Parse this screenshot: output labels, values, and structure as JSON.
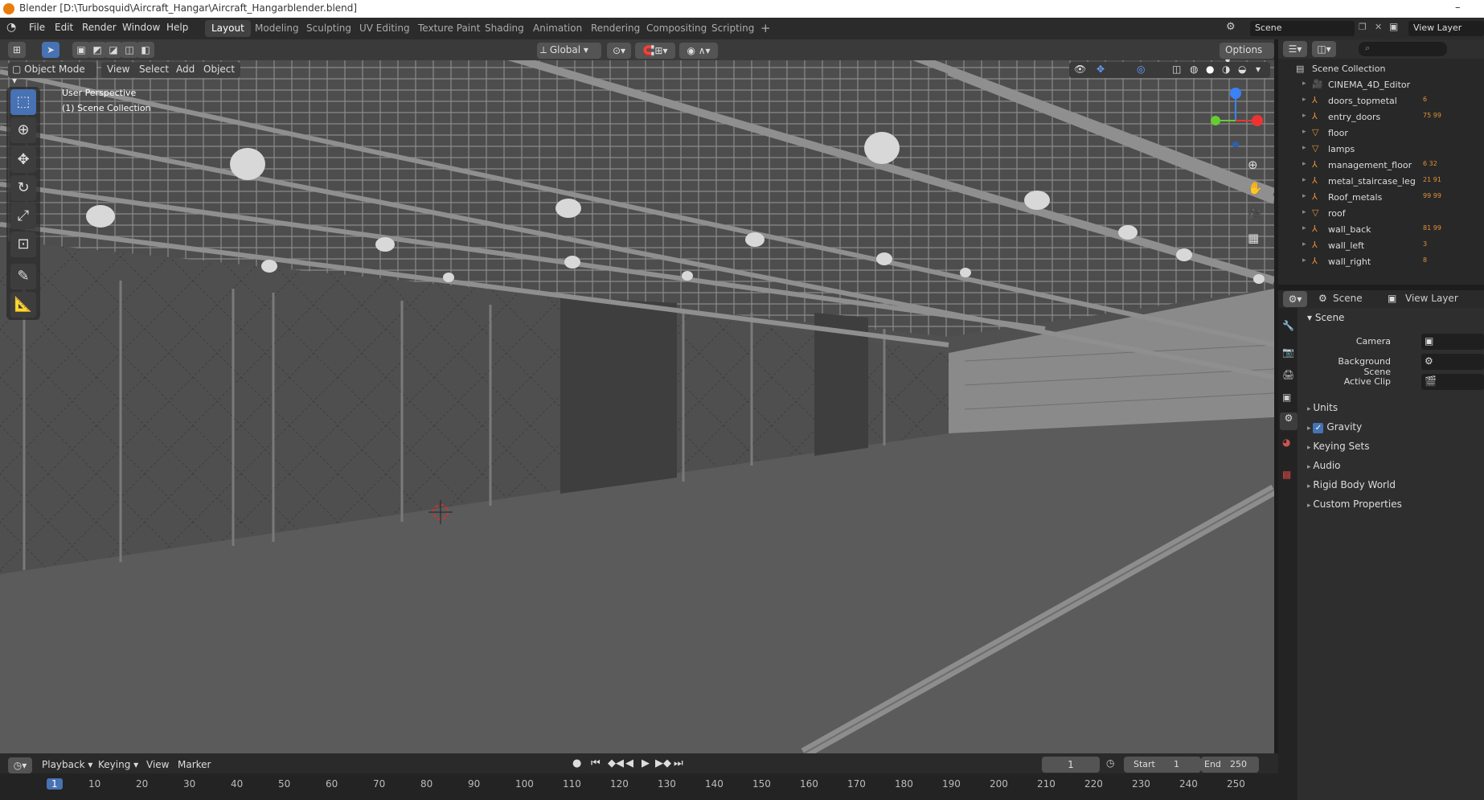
{
  "window": {
    "title": "Blender [D:\\Turbosquid\\Aircraft_Hangar\\Aircraft_Hangarblender.blend]",
    "minimize": "–"
  },
  "menu": [
    "File",
    "Edit",
    "Render",
    "Window",
    "Help"
  ],
  "workspaces": [
    "Layout",
    "Modeling",
    "Sculpting",
    "UV Editing",
    "Texture Paint",
    "Shading",
    "Animation",
    "Rendering",
    "Compositing",
    "Scripting"
  ],
  "active_workspace": "Layout",
  "scene_field": "Scene",
  "view_layer_field": "View Layer",
  "viewport": {
    "transform_orientation": "Global",
    "options_label": "Options",
    "mode": "Object Mode",
    "header_menus": [
      "View",
      "Select",
      "Add",
      "Object"
    ],
    "overlay_line1": "User Perspective",
    "overlay_line2": "(1) Scene Collection"
  },
  "outliner": {
    "root": "Scene Collection",
    "items": [
      {
        "name": "CINEMA_4D_Editor",
        "icon": "camera-icon",
        "badges": ""
      },
      {
        "name": "doors_topmetal",
        "icon": "empty-icon",
        "badges": "6"
      },
      {
        "name": "entry_doors",
        "icon": "empty-icon",
        "badges": "75 99"
      },
      {
        "name": "floor",
        "icon": "mesh-icon",
        "badges": ""
      },
      {
        "name": "lamps",
        "icon": "mesh-icon",
        "badges": ""
      },
      {
        "name": "management_floor",
        "icon": "empty-icon",
        "badges": "6 32"
      },
      {
        "name": "metal_staircase_leg",
        "icon": "empty-icon",
        "badges": "21 91"
      },
      {
        "name": "Roof_metals",
        "icon": "empty-icon",
        "badges": "99 99"
      },
      {
        "name": "roof",
        "icon": "mesh-icon",
        "badges": ""
      },
      {
        "name": "wall_back",
        "icon": "empty-icon",
        "badges": "81 99"
      },
      {
        "name": "wall_left",
        "icon": "empty-icon",
        "badges": "3"
      },
      {
        "name": "wall_right",
        "icon": "empty-icon",
        "badges": "8"
      }
    ]
  },
  "properties": {
    "tab_scene": "Scene",
    "tab_view_layer": "View Layer",
    "panel_title": "Scene",
    "camera_label": "Camera",
    "bg_scene_label": "Background Scene",
    "active_clip_label": "Active Clip",
    "sections": [
      "Units",
      "Gravity",
      "Keying Sets",
      "Audio",
      "Rigid Body World",
      "Custom Properties"
    ],
    "gravity_checked": true
  },
  "timeline": {
    "menus": [
      "Playback",
      "Keying",
      "View",
      "Marker"
    ],
    "current_frame": "1",
    "start_label": "Start",
    "start_value": "1",
    "end_label": "End",
    "end_value": "250",
    "ruler": [
      "1",
      "10",
      "20",
      "30",
      "40",
      "50",
      "60",
      "70",
      "80",
      "90",
      "100",
      "110",
      "120",
      "130",
      "140",
      "150",
      "160",
      "170",
      "180",
      "190",
      "200",
      "210",
      "220",
      "230",
      "240",
      "250"
    ]
  },
  "colors": {
    "accent": "#4772b3",
    "orange": "#e0913a",
    "green": "#51c27b",
    "viewport_bg": "#505050"
  }
}
